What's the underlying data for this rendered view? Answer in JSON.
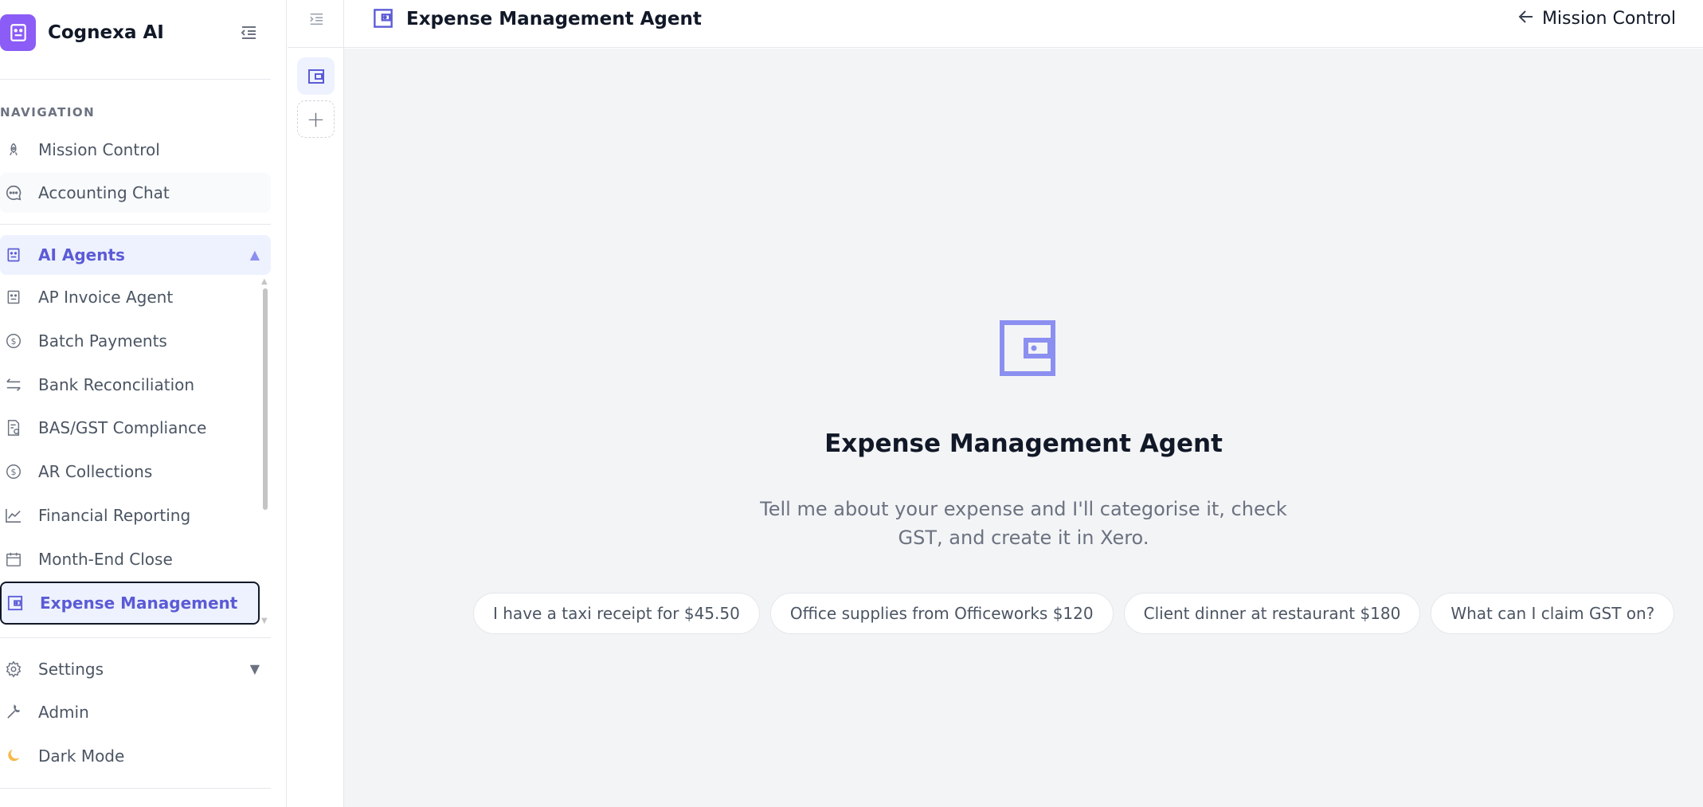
{
  "brand": {
    "name": "Cognexa AI"
  },
  "sidebar": {
    "nav_heading": "NAVIGATION",
    "primary": [
      {
        "label": "Mission Control",
        "icon": "rocket-icon"
      },
      {
        "label": "Accounting Chat",
        "icon": "chat-icon"
      }
    ],
    "agents_group": {
      "label": "AI Agents",
      "icon": "robot-icon",
      "expanded": true
    },
    "agents": [
      {
        "label": "AP Invoice Agent",
        "icon": "robot-icon"
      },
      {
        "label": "Batch Payments",
        "icon": "dollar-icon"
      },
      {
        "label": "Bank Reconciliation",
        "icon": "arrows-icon"
      },
      {
        "label": "BAS/GST Compliance",
        "icon": "receipt-icon"
      },
      {
        "label": "AR Collections",
        "icon": "dollar-icon"
      },
      {
        "label": "Financial Reporting",
        "icon": "chart-icon"
      },
      {
        "label": "Month-End Close",
        "icon": "calendar-icon"
      },
      {
        "label": "Expense Management",
        "icon": "wallet-icon",
        "active": true
      }
    ],
    "bottom": [
      {
        "label": "Settings",
        "icon": "gear-icon",
        "expandable": true
      },
      {
        "label": "Admin",
        "icon": "wrench-icon"
      },
      {
        "label": "Dark Mode",
        "icon": "moon-icon"
      }
    ]
  },
  "header": {
    "title": "Expense Management Agent",
    "back_label": "Mission Control"
  },
  "main": {
    "hero_title": "Expense Management Agent",
    "hero_description": "Tell me about your expense and I'll categorise it, check GST, and create it in Xero.",
    "suggestions": [
      "I have a taxi receipt for $45.50",
      "Office supplies from Officeworks $120",
      "Client dinner at restaurant $180",
      "What can I claim GST on?"
    ]
  },
  "colors": {
    "accent": "#5b5bd6",
    "logo_bg": "#8b5cf6",
    "icon_accent": "#8b8ff0",
    "main_bg": "#f3f4f6",
    "moon": "#f6b94a"
  }
}
